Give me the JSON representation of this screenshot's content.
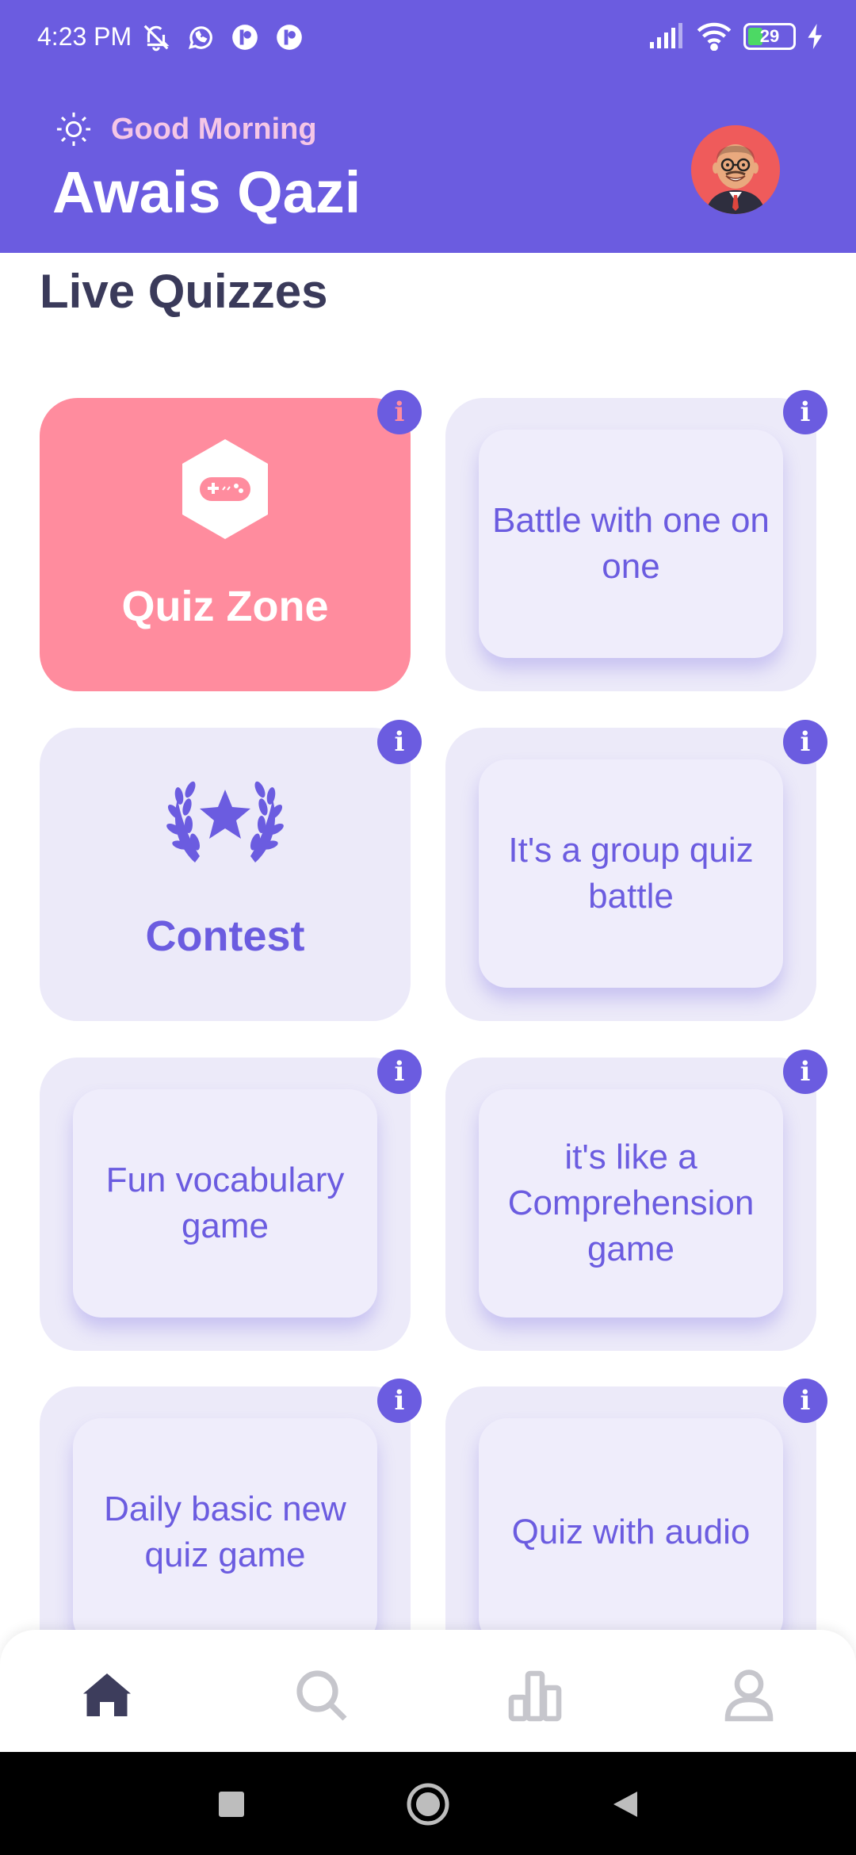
{
  "status_bar": {
    "time": "4:23 PM",
    "battery": "29"
  },
  "header": {
    "greeting": "Good Morning",
    "user_name": "Awais Qazi",
    "greeting_icon": "sun-icon",
    "avatar_icon": "avatar"
  },
  "section": {
    "title": "Live Quizzes"
  },
  "cards": [
    {
      "label": "Quiz Zone",
      "icon": "gamepad-icon"
    },
    {
      "label": "Battle with one on one"
    },
    {
      "label": "Contest",
      "icon": "laurel-star-icon"
    },
    {
      "label": "It's a group quiz battle"
    },
    {
      "label": "Fun vocabulary game"
    },
    {
      "label": "it's like a Comprehension game"
    },
    {
      "label": "Daily basic new quiz game"
    },
    {
      "label": "Quiz with audio"
    }
  ],
  "info_label": "i",
  "bottom_nav": [
    {
      "icon": "home-icon",
      "active": true
    },
    {
      "icon": "search-icon",
      "active": false
    },
    {
      "icon": "leaderboard-icon",
      "active": false
    },
    {
      "icon": "profile-icon",
      "active": false
    }
  ],
  "colors": {
    "primary": "#6b5ce0",
    "accent_pink": "#ff8c9e",
    "card_bg": "#eceaf9",
    "greeting": "#f5c6e6",
    "title": "#3a3a5a"
  }
}
